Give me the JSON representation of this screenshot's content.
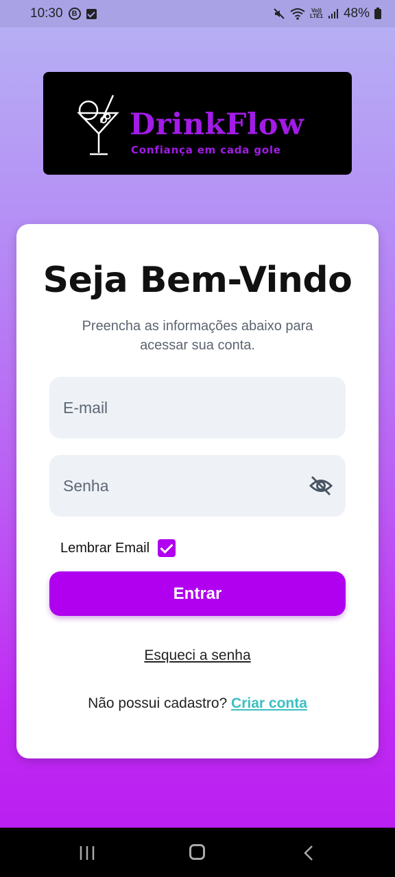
{
  "status_bar": {
    "time": "10:30",
    "badge_letter": "B",
    "volte_top": "Vo))",
    "volte_bottom": "LTE1",
    "battery": "48%"
  },
  "logo": {
    "title": "DrinkFlow",
    "tagline": "Confiança em cada gole",
    "brand_color": "#a21be6"
  },
  "login": {
    "heading": "Seja Bem-Vindo",
    "subtitle": "Preencha as informações abaixo para acessar sua conta.",
    "email_placeholder": "E-mail",
    "email_value": "",
    "password_placeholder": "Senha",
    "password_value": "",
    "remember_label": "Lembrar Email",
    "remember_checked": true,
    "submit_label": "Entrar",
    "forgot_label": "Esqueci a senha",
    "signup_prompt": "Não possui cadastro?",
    "signup_link": "Criar conta"
  },
  "colors": {
    "accent": "#b000ef",
    "link": "#3bbfc2"
  },
  "icons": {
    "password_toggle": "eye-off-icon",
    "nav_recent": "recent-apps-icon",
    "nav_home": "home-icon",
    "nav_back": "back-icon"
  }
}
